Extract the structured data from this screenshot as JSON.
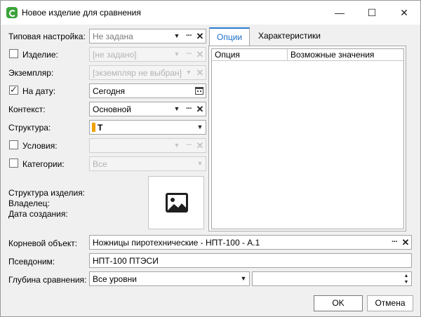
{
  "window": {
    "title": "Новое изделие для сравнения"
  },
  "window_controls": {
    "minimize": "—",
    "maximize": "☐",
    "close": "✕"
  },
  "form": {
    "typical": {
      "label": "Типовая настройка:",
      "value": "Не задана"
    },
    "item": {
      "label": "Изделие:",
      "value": "[не задано]",
      "checked": false
    },
    "instance": {
      "label": "Экземпляр:",
      "value": "[экземпляр не выбран]"
    },
    "date": {
      "label": "На дату:",
      "value": "Сегодня",
      "checked": true
    },
    "context": {
      "label": "Контекст:",
      "value": "Основной"
    },
    "structure": {
      "label": "Структура:",
      "value": "T"
    },
    "conditions": {
      "label": "Условия:",
      "value": "",
      "checked": false
    },
    "categories": {
      "label": "Категории:",
      "value": "Все",
      "checked": false
    }
  },
  "info": {
    "structure_label": "Структура изделия:",
    "owner_label": "Владелец:",
    "created_label": "Дата создания:"
  },
  "tabs": [
    {
      "label": "Опции",
      "active": true
    },
    {
      "label": "Характеристики",
      "active": false
    }
  ],
  "options_grid": {
    "columns": [
      "Опция",
      "Возможные значения"
    ]
  },
  "root": {
    "label": "Корневой объект:",
    "value": "Ножницы пиротехнические - НПТ-100 - А.1"
  },
  "alias": {
    "label": "Псевдоним:",
    "value": "НПТ-100 ПТЭСИ"
  },
  "depth": {
    "label": "Глубина сравнения:",
    "value": "Все уровни",
    "number": ""
  },
  "buttons": {
    "ok": "OK",
    "cancel": "Отмена"
  },
  "glyphs": {
    "dropdown": "▼",
    "more": "···",
    "clear": "✕",
    "spin_up": "▲",
    "spin_down": "▼"
  },
  "colors": {
    "accent": "#2b7bd0",
    "structure_mark": "#f0a000",
    "app_icon": "#3aa33a"
  }
}
